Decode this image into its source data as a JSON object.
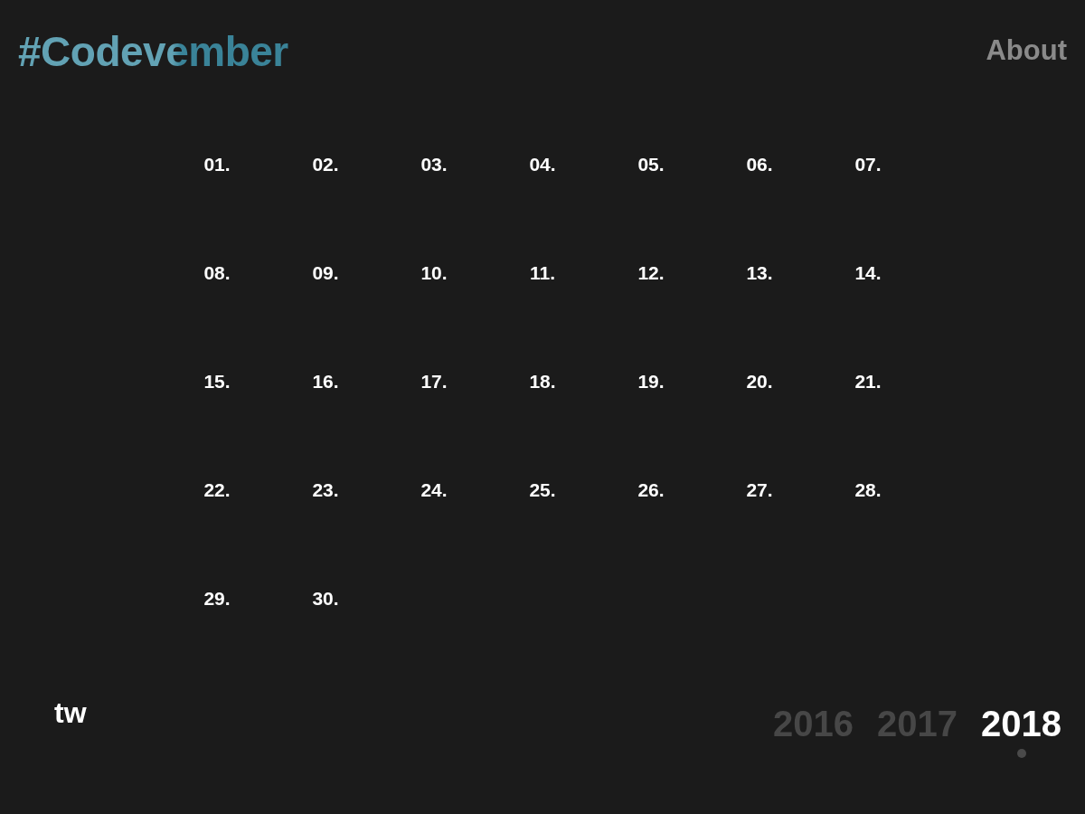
{
  "header": {
    "logo": "#Codevember",
    "nav_link": "About"
  },
  "days": [
    "01.",
    "02.",
    "03.",
    "04.",
    "05.",
    "06.",
    "07.",
    "08.",
    "09.",
    "10.",
    "11.",
    "12.",
    "13.",
    "14.",
    "15.",
    "16.",
    "17.",
    "18.",
    "19.",
    "20.",
    "21.",
    "22.",
    "23.",
    "24.",
    "25.",
    "26.",
    "27.",
    "28.",
    "29.",
    "30."
  ],
  "footer": {
    "social_link": "tw",
    "years": [
      {
        "label": "2016",
        "selected": false
      },
      {
        "label": "2017",
        "selected": false
      },
      {
        "label": "2018",
        "selected": true
      }
    ]
  }
}
